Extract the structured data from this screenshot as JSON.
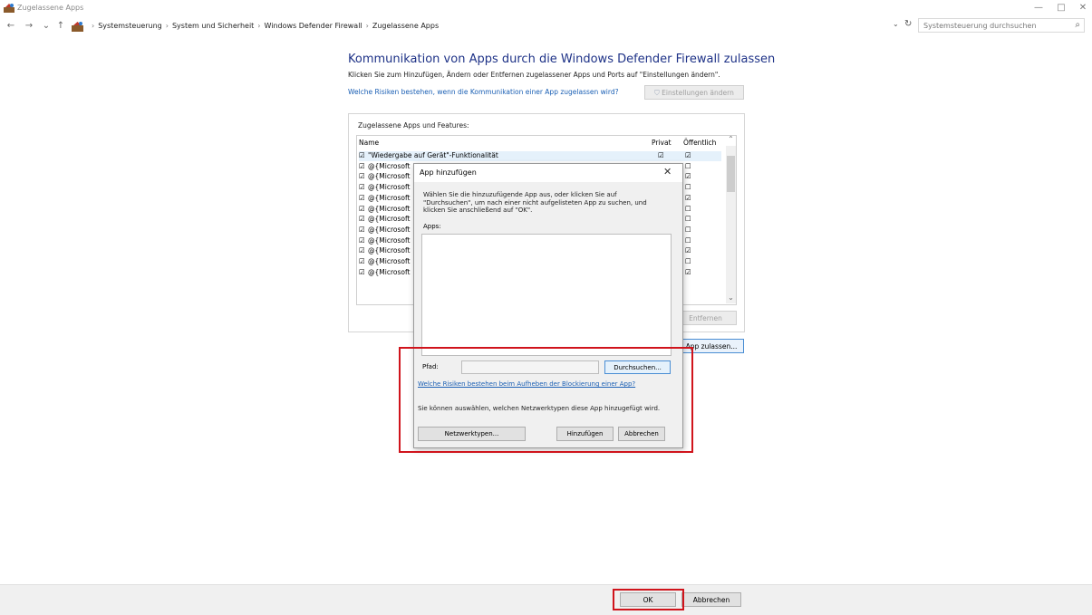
{
  "window": {
    "title": "Zugelassene Apps",
    "minimize": "—",
    "maximize": "□",
    "close": "✕"
  },
  "nav": {
    "back": "←",
    "forward": "→",
    "recent": "⌄",
    "up": "↑"
  },
  "breadcrumbs": [
    "Systemsteuerung",
    "System und Sicherheit",
    "Windows Defender Firewall",
    "Zugelassene Apps"
  ],
  "search": {
    "placeholder": "Systemsteuerung durchsuchen"
  },
  "main": {
    "heading": "Kommunikation von Apps durch die Windows Defender Firewall zulassen",
    "subtext": "Klicken Sie zum Hinzufügen, Ändern oder Entfernen zugelassener Apps und Ports auf \"Einstellungen ändern\".",
    "risk_link": "Welche Risiken bestehen, wenn die Kommunikation einer App zugelassen wird?",
    "settings_button": "Einstellungen ändern",
    "group_label": "Zugelassene Apps und Features:",
    "columns": {
      "name": "Name",
      "private": "Privat",
      "public": "Öffentlich"
    },
    "rows": [
      {
        "name": "\"Wiedergabe auf Gerät\"-Funktionalität",
        "private": true,
        "public": true
      },
      {
        "name": "@{Microsoft",
        "private": true,
        "public": false
      },
      {
        "name": "@{Microsoft",
        "private": true,
        "public": true
      },
      {
        "name": "@{Microsoft",
        "private": true,
        "public": false
      },
      {
        "name": "@{Microsoft",
        "private": true,
        "public": true
      },
      {
        "name": "@{Microsoft",
        "private": true,
        "public": false
      },
      {
        "name": "@{Microsoft",
        "private": true,
        "public": false
      },
      {
        "name": "@{Microsoft",
        "private": true,
        "public": false
      },
      {
        "name": "@{Microsoft",
        "private": true,
        "public": false
      },
      {
        "name": "@{Microsoft",
        "private": true,
        "public": true
      },
      {
        "name": "@{Microsoft",
        "private": true,
        "public": false
      },
      {
        "name": "@{Microsoft",
        "private": true,
        "public": true
      }
    ],
    "remove_button": "Entfernen",
    "allow_app_button": "App zulassen..."
  },
  "dialog": {
    "title": "App hinzufügen",
    "instructions": "Wählen Sie die hinzuzufügende App aus, oder klicken Sie auf \"Durchsuchen\", um nach einer nicht aufgelisteten App zu suchen, und klicken Sie anschließend auf \"OK\".",
    "apps_label": "Apps:",
    "path_label": "Pfad:",
    "path_value": "",
    "browse_button": "Durchsuchen...",
    "risk_link": "Welche Risiken bestehen beim Aufheben der Blockierung einer App?",
    "network_note": "Sie können auswählen, welchen Netzwerktypen diese App hinzugefügt wird.",
    "network_types_button": "Netzwerktypen...",
    "add_button": "Hinzufügen",
    "cancel_button": "Abbrechen"
  },
  "footer": {
    "ok_button": "OK",
    "cancel_button": "Abbrechen"
  },
  "colors": {
    "heading": "#1e3287",
    "link": "#1a5fb4",
    "highlight": "#d0141c"
  }
}
